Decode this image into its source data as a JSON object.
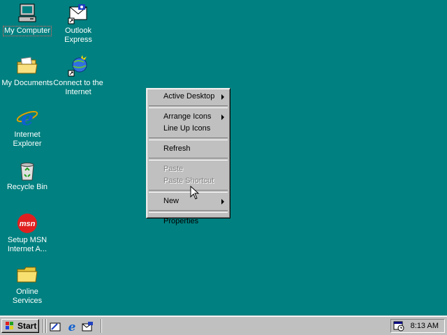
{
  "desktop": {
    "icons": [
      {
        "label": "My Computer",
        "icon": "my-computer-icon"
      },
      {
        "label": "Outlook Express",
        "icon": "outlook-express-icon"
      },
      {
        "label": "My Documents",
        "icon": "folder-icon"
      },
      {
        "label": "Connect to the Internet",
        "icon": "connect-internet-icon"
      },
      {
        "label": "Internet Explorer",
        "icon": "internet-explorer-icon"
      },
      {
        "label": "Recycle Bin",
        "icon": "recycle-bin-icon"
      },
      {
        "label": "Setup MSN Internet A...",
        "icon": "msn-icon"
      },
      {
        "label": "Online Services",
        "icon": "folder-icon"
      }
    ]
  },
  "context_menu": {
    "active_desktop": "Active Desktop",
    "arrange_icons": "Arrange Icons",
    "line_up_icons": "Line Up Icons",
    "refresh": "Refresh",
    "paste": "Paste",
    "paste_shortcut": "Paste Shortcut",
    "new": "New",
    "properties": "Properties"
  },
  "taskbar": {
    "start_label": "Start",
    "clock": "8:13 AM",
    "quick_launch": [
      "show-desktop-icon",
      "internet-explorer-icon",
      "outlook-express-icon"
    ]
  },
  "colors": {
    "desktop_background": "#008080",
    "face": "#c0c0c0"
  }
}
